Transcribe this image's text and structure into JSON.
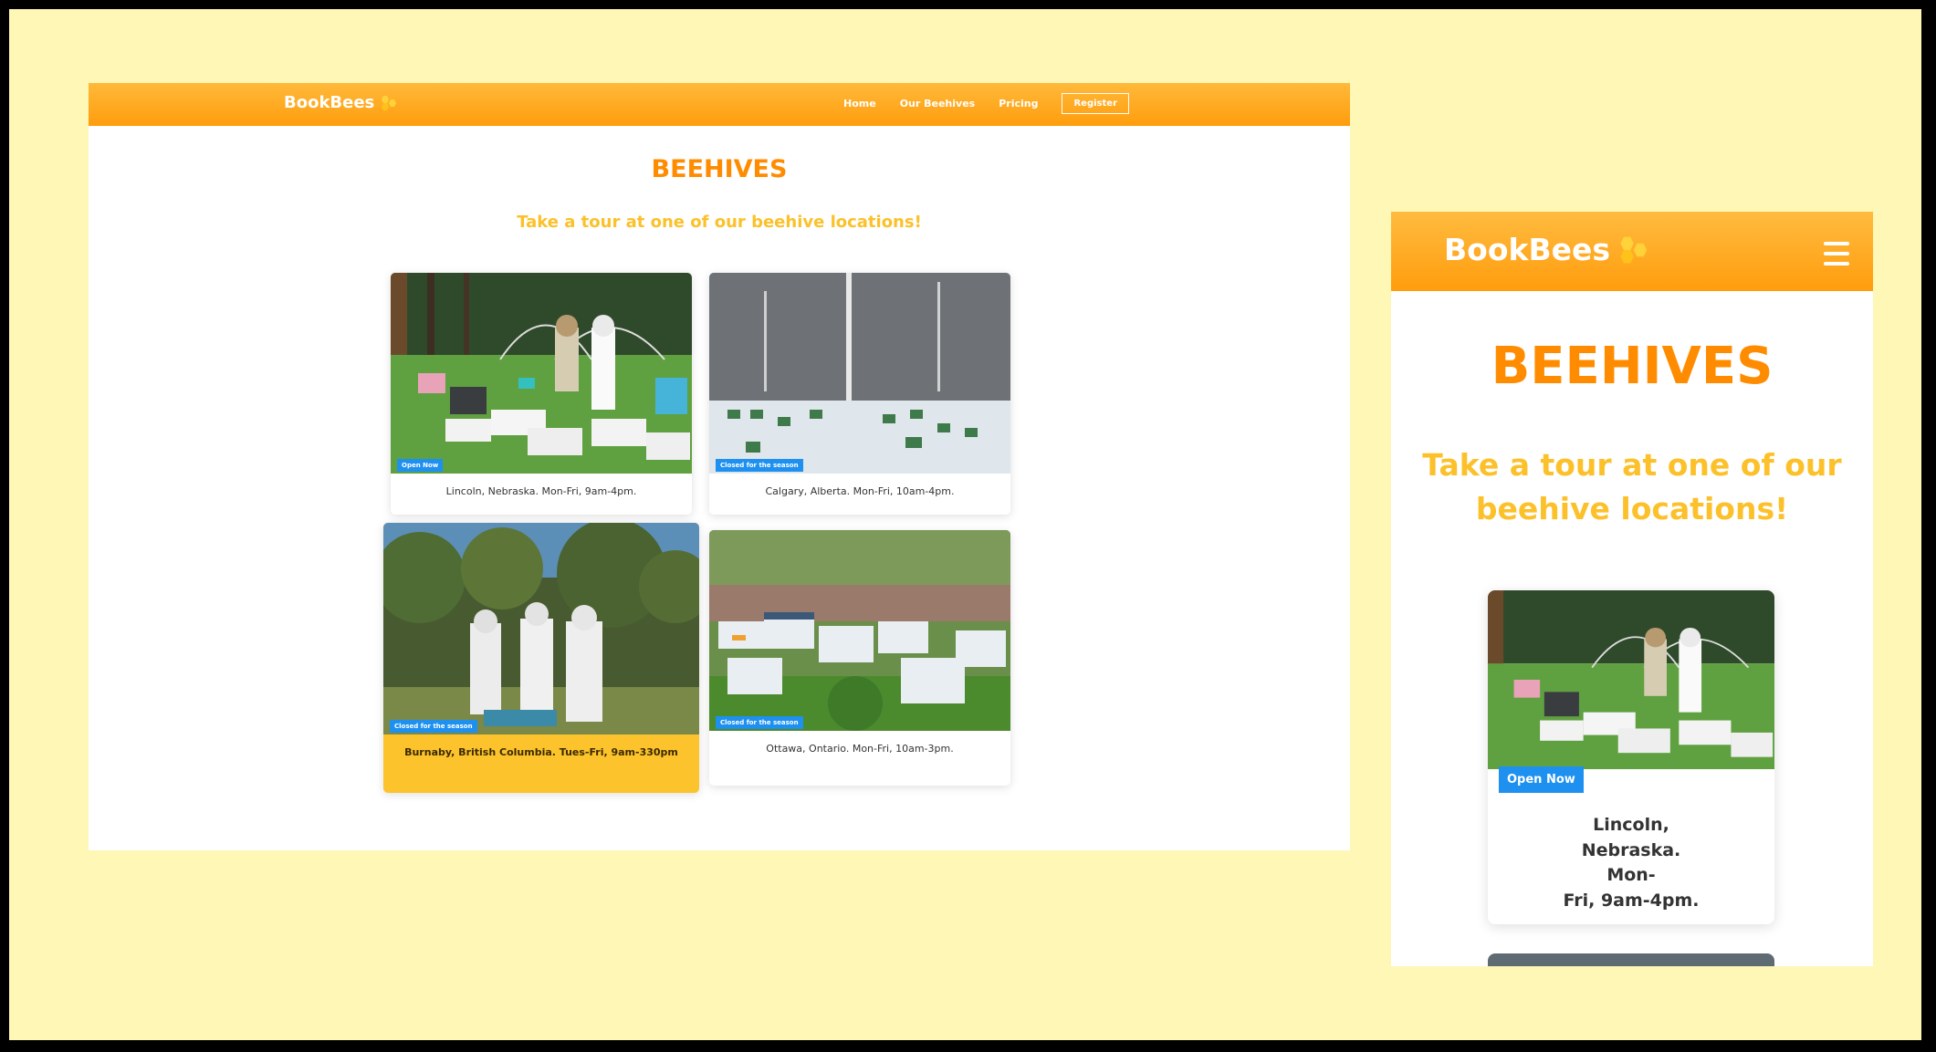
{
  "brand": "BookBees",
  "nav": {
    "links": [
      "Home",
      "Our Beehives",
      "Pricing"
    ],
    "register": "Register"
  },
  "page": {
    "title": "BEEHIVES",
    "subtitle": "Take a tour at one of our beehive locations!"
  },
  "locations": [
    {
      "caption": "Lincoln, Nebraska. Mon-Fri, 9am-4pm.",
      "status": "Open Now"
    },
    {
      "caption": "Calgary, Alberta. Mon-Fri, 10am-4pm.",
      "status": "Closed for the season"
    },
    {
      "caption": "Burnaby, British Columbia. Tues-Fri, 9am-330pm",
      "status": "Closed for the season"
    },
    {
      "caption": "Ottawa, Ontario. Mon-Fri, 10am-3pm.",
      "status": "Closed for the season"
    }
  ],
  "mobile": {
    "menu_icon": "hamburger-icon",
    "caption_lines": [
      "Lincoln,",
      "Nebraska. Mon-",
      "Fri, 9am-4pm."
    ]
  },
  "colors": {
    "nav_orange": "#ff9d0d",
    "title_orange": "#ff8c00",
    "subtitle_yellow": "#fcc12a",
    "badge_blue": "#1e90f0",
    "hover_card": "#fdc32c",
    "backdrop": "#fff7b6"
  }
}
